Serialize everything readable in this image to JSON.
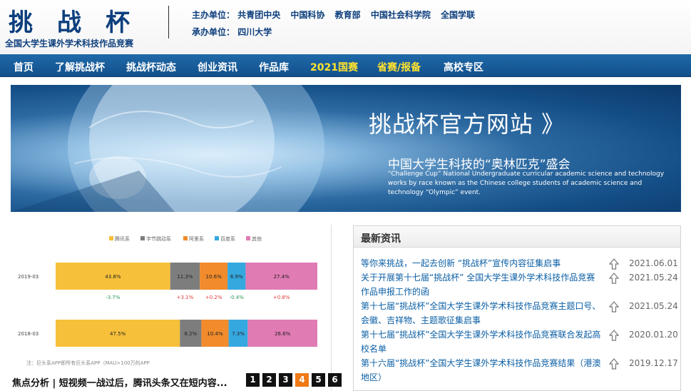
{
  "header": {
    "logo_title": "挑战杯",
    "logo_subtitle": "全国大学生课外学术科技作品竞赛",
    "host_label": "主办单位：",
    "hosts": [
      "共青团中央",
      "中国科协",
      "教育部",
      "中国社会科学院",
      "全国学联"
    ],
    "organizer_label": "承办单位：",
    "organizer": "四川大学"
  },
  "nav": {
    "items": [
      {
        "label": "首页"
      },
      {
        "label": "了解挑战杯"
      },
      {
        "label": "挑战杯动态"
      },
      {
        "label": "创业资讯"
      },
      {
        "label": "作品库"
      },
      {
        "label": "2021国赛"
      },
      {
        "label": "省赛/报备"
      },
      {
        "label": "高校专区"
      }
    ]
  },
  "banner": {
    "title": "挑战杯官方网站 》",
    "subtitle": "中国大学生科技的“奥林匹克”盛会",
    "english": "“Challenge Cup” National Undergraduate curricular academic science and technology works by race known as the Chinese college students of academic science and technology “Olympic” event."
  },
  "focus": {
    "caption": "焦点分析 | 短视频一战过后，腾讯头条又在短内容...",
    "pages": [
      "1",
      "2",
      "3",
      "4",
      "5",
      "6"
    ],
    "active_page": "4"
  },
  "chart_data": {
    "type": "bar",
    "legend": [
      "腾讯系",
      "字节跳动系",
      "阿里系",
      "百度系",
      "其他"
    ],
    "colors": [
      "#f7c03a",
      "#7d7d7d",
      "#f18b2c",
      "#35a8e0",
      "#e07bb4"
    ],
    "categories": [
      "2019-03",
      "2018-03"
    ],
    "series": [
      {
        "name": "腾讯系",
        "values": [
          43.8,
          47.5
        ]
      },
      {
        "name": "字节跳动系",
        "values": [
          11.3,
          8.2
        ]
      },
      {
        "name": "阿里系",
        "values": [
          10.6,
          10.4
        ]
      },
      {
        "name": "百度系",
        "values": [
          6.9,
          7.3
        ]
      },
      {
        "name": "其他",
        "values": [
          27.4,
          26.6
        ]
      }
    ],
    "changes": [
      "-3.7%",
      "+3.1%",
      "+0.2%",
      "-0.4%",
      "+0.8%"
    ],
    "footnote": "注：巨头系APP即所有巨头系APP（MAU>100万的APP"
  },
  "news": {
    "heading": "最新资讯",
    "items": [
      {
        "title": "等你来挑战，一起去创新 “挑战杯”宣传内容征集启事",
        "date": "2021.06.01"
      },
      {
        "title": "关于开展第十七届“挑战杯” 全国大学生课外学术科技作品竞赛作品申报工作的函",
        "date": "2021.05.24"
      },
      {
        "title": "第十七届“挑战杯”全国大学生课外学术科技作品竞赛主题口号、会徽、吉祥物、主题歌征集启事",
        "date": "2021.05.24"
      },
      {
        "title": "第十七届“挑战杯”全国大学生课外学术科技作品竞赛联合发起高校名单",
        "date": "2020.01.20"
      },
      {
        "title": "第十六届“挑战杯”全国大学生课外学术科技作品竞赛结果（港澳地区）",
        "date": "2019.12.17"
      }
    ]
  }
}
